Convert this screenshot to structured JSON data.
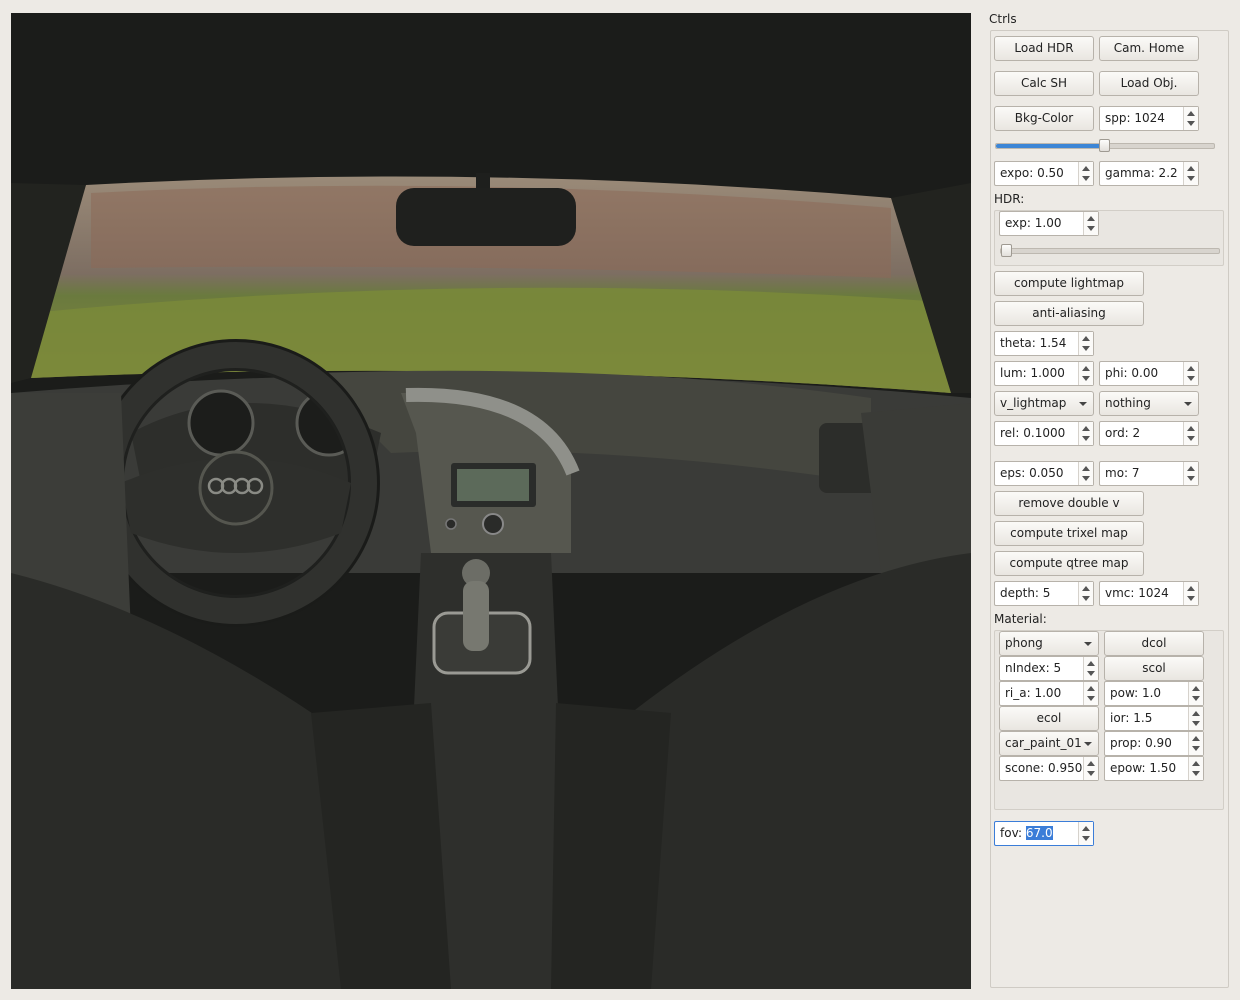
{
  "panel": {
    "title": "Ctrls",
    "buttons": {
      "load_hdr": "Load HDR",
      "cam_home": "Cam. Home",
      "calc_sh": "Calc SH",
      "load_obj": "Load Obj.",
      "bkg_color": "Bkg-Color",
      "compute_lightmap": "compute lightmap",
      "anti_aliasing": "anti-aliasing",
      "remove_double_v": "remove double v",
      "compute_trixel_map": "compute trixel map",
      "compute_qtree_map": "compute qtree map"
    },
    "spp": "spp: 1024",
    "spp_slider": {
      "value": 0.5
    },
    "expo": "expo: 0.50",
    "gamma": "gamma: 2.2",
    "hdr_label": "HDR:",
    "hdr_exp": "exp: 1.00",
    "hdr_slider": {
      "value": 0.0
    },
    "theta": "theta: 1.54",
    "lum": "lum: 1.000",
    "phi": "phi: 0.00",
    "map_mode": "v_lightmap",
    "second_mode": "nothing",
    "rel": "rel: 0.1000",
    "ord": "ord: 2",
    "eps": "eps: 0.050",
    "mo": "mo: 7",
    "depth": "depth: 5",
    "vmc": "vmc: 1024",
    "material_label": "Material:",
    "material": {
      "shader": "phong",
      "dcol": "dcol",
      "nindex": "nIndex: 5",
      "scol": "scol",
      "ri_a": "ri_a: 1.00",
      "pow": "pow: 1.0",
      "ecol": "ecol",
      "ior": "ior: 1.5",
      "material_name": "car_paint_01",
      "prop": "prop: 0.90",
      "scone": "scone: 0.950",
      "epow": "epow: 1.50"
    },
    "fov_prefix": "fov: ",
    "fov_value": "67.0"
  },
  "colors": {
    "accent": "#3b7dd8",
    "panel_bg": "#edeae5",
    "viewport_bg": "#1b1c1a"
  }
}
